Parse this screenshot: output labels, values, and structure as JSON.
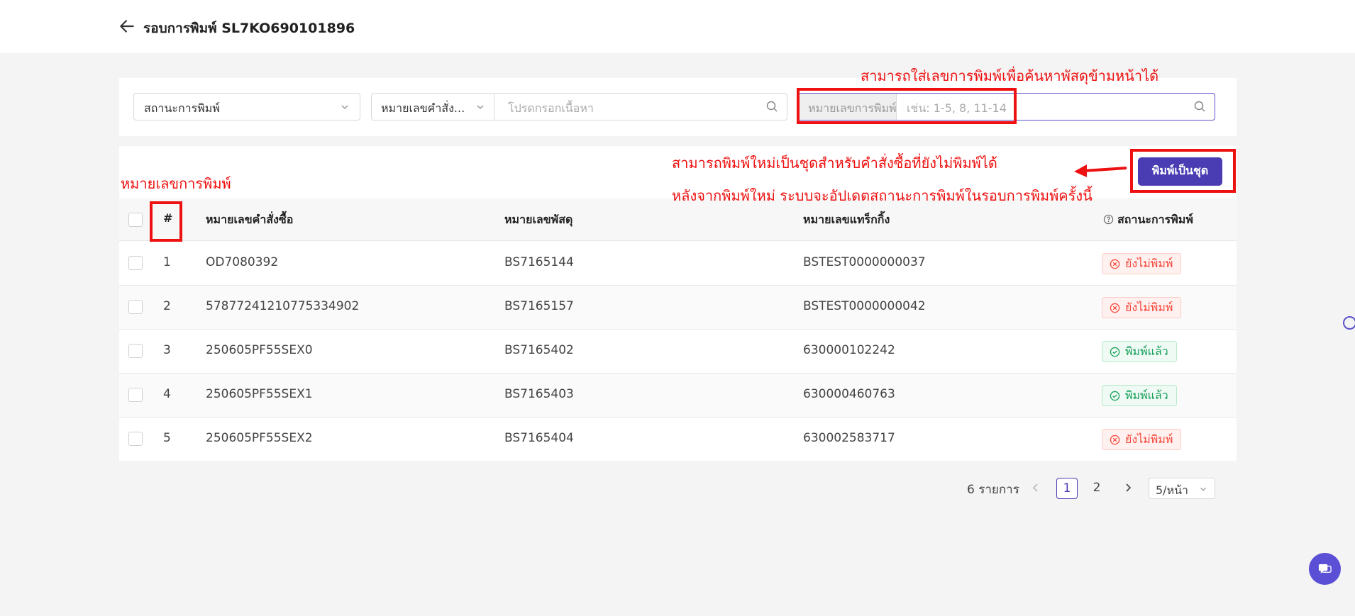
{
  "header": {
    "title": "รอบการพิมพ์ SL7KO690101896"
  },
  "filters": {
    "status_select": "สถานะการพิมพ์",
    "order_type_select": "หมายเลขคำสั่ง...",
    "order_search_placeholder": "โปรดกรอกเนื้อหา",
    "print_no_label": "หมายเลขการพิมพ์",
    "print_no_placeholder": "เช่น: 1-5, 8, 11-14"
  },
  "actions": {
    "batch_print": "พิมพ์เป็นชุด"
  },
  "table": {
    "columns": {
      "no": "#",
      "order": "หมายเลขคำสั่งซื้อ",
      "parcel": "หมายเลขพัสดุ",
      "tracking": "หมายเลขแทร็กกิ้ง",
      "status": "สถานะการพิมพ์"
    },
    "rows": [
      {
        "no": "1",
        "order": "OD7080392",
        "parcel": "BS7165144",
        "tracking": "BSTEST0000000037",
        "status": "ยังไม่พิมพ์"
      },
      {
        "no": "2",
        "order": "57877241210775334902",
        "parcel": "BS7165157",
        "tracking": "BSTEST0000000042",
        "status": "ยังไม่พิมพ์"
      },
      {
        "no": "3",
        "order": "250605PF55SEX0",
        "parcel": "BS7165402",
        "tracking": "630000102242",
        "status": "พิมพ์แล้ว"
      },
      {
        "no": "4",
        "order": "250605PF55SEX1",
        "parcel": "BS7165403",
        "tracking": "630000460763",
        "status": "พิมพ์แล้ว"
      },
      {
        "no": "5",
        "order": "250605PF55SEX2",
        "parcel": "BS7165404",
        "tracking": "630002583717",
        "status": "ยังไม่พิมพ์"
      }
    ]
  },
  "pagination": {
    "total": "6 รายการ",
    "page1": "1",
    "page2": "2",
    "page_size": "5/หน้า"
  },
  "annotations": {
    "search_note": "สามารถใส่เลขการพิมพ์เพื่อค้นหาพัสดุข้ามหน้าได้",
    "reprint_line1": "สามารถพิมพ์ใหม่เป็นชุดสำหรับคำสั่งซื้อที่ยังไม่พิมพ์ได้",
    "reprint_line2": "หลังจากพิมพ์ใหม่ ระบบจะอัปเดตสถานะการพิมพ์ในรอบการพิมพ์ครั้งนี้",
    "print_no_note": "หมายเลขการพิมพ์"
  },
  "colors": {
    "accent": "#4a3db3",
    "annotation_red": "#ee1111",
    "not_printed": "#f5483b",
    "printed": "#17a05a"
  },
  "icons": {
    "back": "arrow-left-icon",
    "search": "search-icon",
    "help": "question-circle-icon",
    "not_printed": "close-circle-icon",
    "printed": "check-circle-icon",
    "chat": "chat-icon"
  }
}
